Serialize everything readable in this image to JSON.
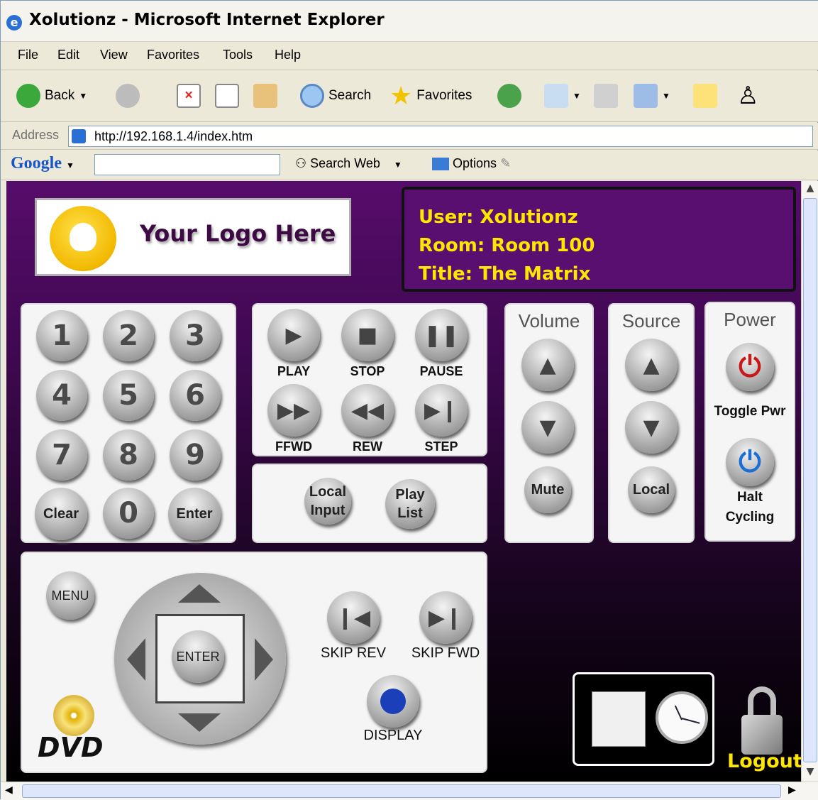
{
  "window": {
    "title": "Xolutionz - Microsoft Internet Explorer"
  },
  "menu": [
    "File",
    "Edit",
    "View",
    "Favorites",
    "Tools",
    "Help"
  ],
  "toolbar": {
    "back": "Back",
    "search": "Search",
    "favorites": "Favorites"
  },
  "address": {
    "label": "Address",
    "url": "http://192.168.1.4/index.htm"
  },
  "google_bar": {
    "brand": "Google",
    "search_web": "Search Web",
    "options": "Options"
  },
  "logo": {
    "text": "Your Logo Here"
  },
  "info": {
    "user": "User: Xolutionz",
    "room": "Room: Room 100",
    "title": "Title: The Matrix"
  },
  "keypad": {
    "keys": [
      "1",
      "2",
      "3",
      "4",
      "5",
      "6",
      "7",
      "8",
      "9",
      "Clear",
      "0",
      "Enter"
    ]
  },
  "transport": {
    "play": "PLAY",
    "stop": "STOP",
    "pause": "PAUSE",
    "ffwd": "FFWD",
    "rew": "REW",
    "step": "STEP"
  },
  "inputs": {
    "local_input_1": "Local",
    "local_input_2": "Input",
    "play_list_1": "Play",
    "play_list_2": "List"
  },
  "volume": {
    "title": "Volume",
    "mute": "Mute"
  },
  "source": {
    "title": "Source",
    "local": "Local"
  },
  "power": {
    "title": "Power",
    "toggle": "Toggle Pwr",
    "halt_1": "Halt",
    "halt_2": "Cycling"
  },
  "nav": {
    "menu": "MENU",
    "enter": "ENTER",
    "skip_rev": "SKIP REV",
    "skip_fwd": "SKIP FWD",
    "display": "DISPLAY"
  },
  "dvd": {
    "logo": "DVD"
  },
  "footer": {
    "logout": "Logout"
  }
}
